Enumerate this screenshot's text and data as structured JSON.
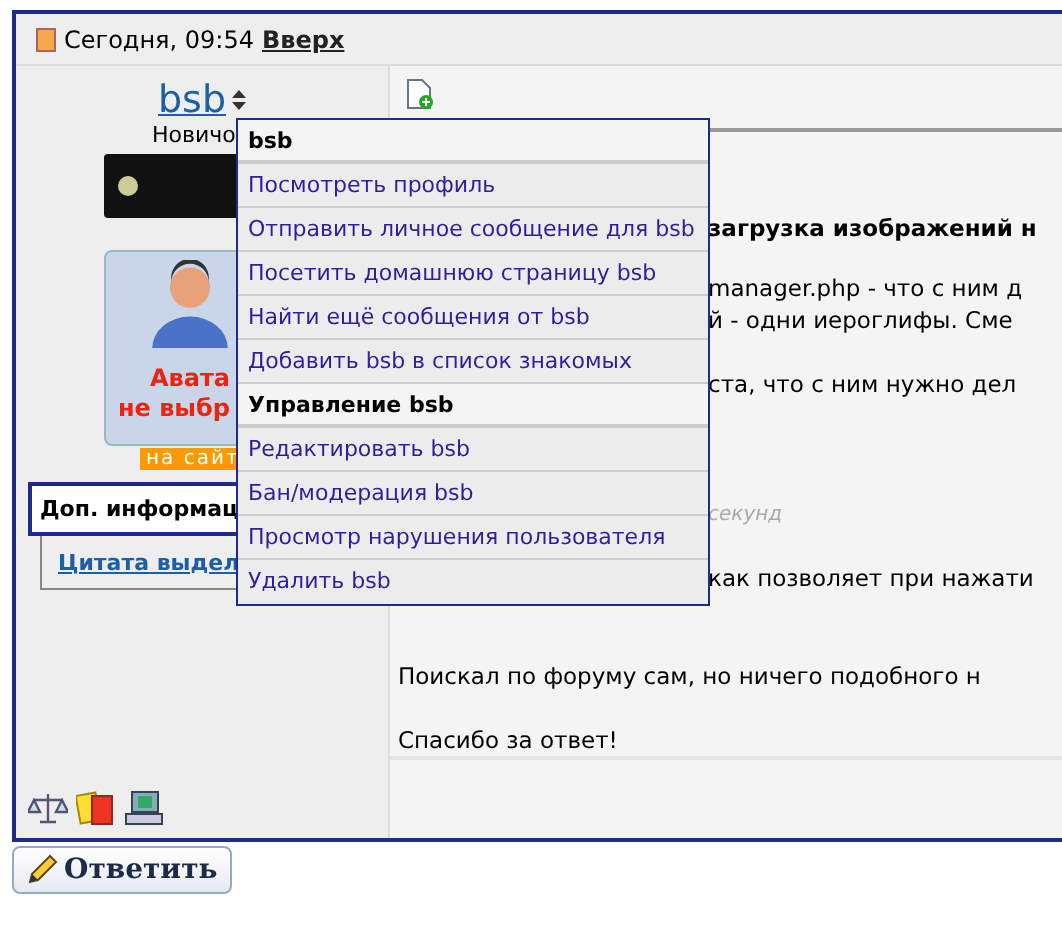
{
  "post_header": {
    "date": "Сегодня, 09:54",
    "top_link": "Вверх"
  },
  "author": {
    "name": "bsb",
    "rank": "Новичо",
    "avatar_text": [
      "Авата",
      "не выбр"
    ],
    "status": "на сайт"
  },
  "side_links": [
    {
      "label": "Доп. информац",
      "kind": "box"
    },
    {
      "label": "Цитата выдел",
      "kind": "link"
    }
  ],
  "post": {
    "covered_paragraphs": [
      {
        "text": "загрузка изображений н",
        "kind": "title"
      },
      {
        "text": "manager.php - что с ним д",
        "kind": "body"
      },
      {
        "text": "й - одни иероглифы. Сме",
        "kind": "body_tight"
      },
      {
        "text": "ста, что с ним нужно дел",
        "kind": "body"
      },
      {
        "text": "секунд",
        "kind": "note"
      },
      {
        "text": "как позволяет при нажати",
        "kind": "body"
      }
    ],
    "paragraphs": [
      "Поискал по форуму сам, но ничего подобного н",
      "Спасибо за ответ!"
    ]
  },
  "user_menu": [
    {
      "label": "bsb",
      "kind": "header"
    },
    {
      "label": "Посмотреть профиль",
      "kind": "item"
    },
    {
      "label": "Отправить личное сообщение для bsb",
      "kind": "item"
    },
    {
      "label": "Посетить домашнюю страницу bsb",
      "kind": "item"
    },
    {
      "label": "Найти ещё сообщения от bsb",
      "kind": "item"
    },
    {
      "label": "Добавить bsb в список знакомых",
      "kind": "item"
    },
    {
      "label": "Управление bsb",
      "kind": "header"
    },
    {
      "label": "Редактировать bsb",
      "kind": "item"
    },
    {
      "label": "Бан/модерация bsb",
      "kind": "item"
    },
    {
      "label": "Просмотр нарушения пользователя",
      "kind": "item"
    },
    {
      "label": "Удалить bsb",
      "kind": "item"
    }
  ],
  "reply_button": "Ответить"
}
